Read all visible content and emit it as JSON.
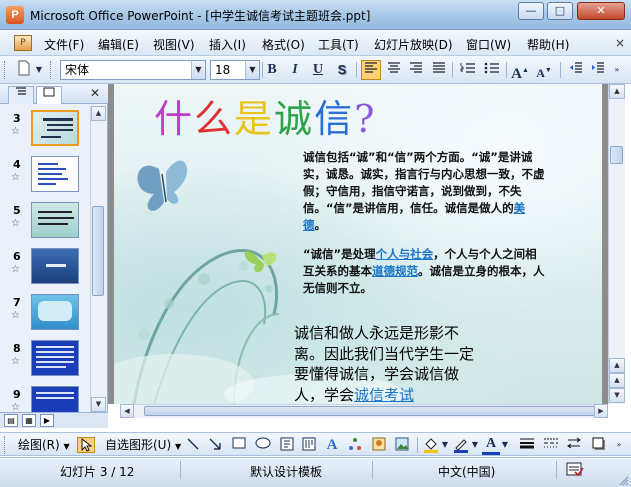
{
  "window": {
    "title": "Microsoft Office PowerPoint - [中学生诚信考试主题班会.ppt]",
    "app_icon": "powerpoint-icon",
    "controls": [
      "minimize-icon",
      "restore-icon",
      "close-icon"
    ]
  },
  "menubar": {
    "items": [
      "文件(F)",
      "编辑(E)",
      "视图(V)",
      "插入(I)",
      "格式(O)",
      "工具(T)",
      "幻灯片放映(D)",
      "窗口(W)",
      "帮助(H)"
    ],
    "close_doc": "×"
  },
  "toolbar": {
    "font_name": "宋体",
    "font_size": "18",
    "bold": "B",
    "italic": "I",
    "underline": "U",
    "shadow": "S",
    "grow_font": "A",
    "shrink_font": "A"
  },
  "thumbnails": {
    "tabs": [
      "outline-tab",
      "slides-tab"
    ],
    "selected_number": "3",
    "items": [
      {
        "number": "3"
      },
      {
        "number": "4"
      },
      {
        "number": "5"
      },
      {
        "number": "6"
      },
      {
        "number": "7"
      },
      {
        "number": "8"
      },
      {
        "number": "9"
      }
    ]
  },
  "slide": {
    "title_chars": [
      "什",
      "么",
      "是",
      "诚",
      "信",
      "?"
    ],
    "title_colors": [
      "#c03cc8",
      "#e0302f",
      "#e8c41a",
      "#2fa24a",
      "#2b6fd6",
      "#8a5bd6"
    ],
    "para1": {
      "text1": "诚信包括“诚”和“信”两个方面。“诚”是讲诚实，诚恳。诚实，指言行与内心思想一致，不虚假；守信用，指信守诺言，说到做到，不失信。“信”是讲信用，信任。诚信是做人的",
      "link": "美德",
      "text2": "。"
    },
    "para2": {
      "text1": "“诚信”是处理",
      "link1": "个人与社会",
      "text2": "，个人与个人之间相互关系的基本",
      "link2": "道德规范",
      "text3": "。诚信是立身的根本，人无信则不立。"
    },
    "para3": {
      "text": "诚信和做人永远是形影不离。因此我们当代学生一定要懂得诚信，学会诚信做人，学会",
      "link": "诚信考试"
    }
  },
  "drawbar": {
    "draw_label": "绘图(R)",
    "autoshape_label": "自选图形(U)"
  },
  "status": {
    "slide_counter": "幻灯片 3 / 12",
    "design": "默认设计模板",
    "language": "中文(中国)"
  }
}
